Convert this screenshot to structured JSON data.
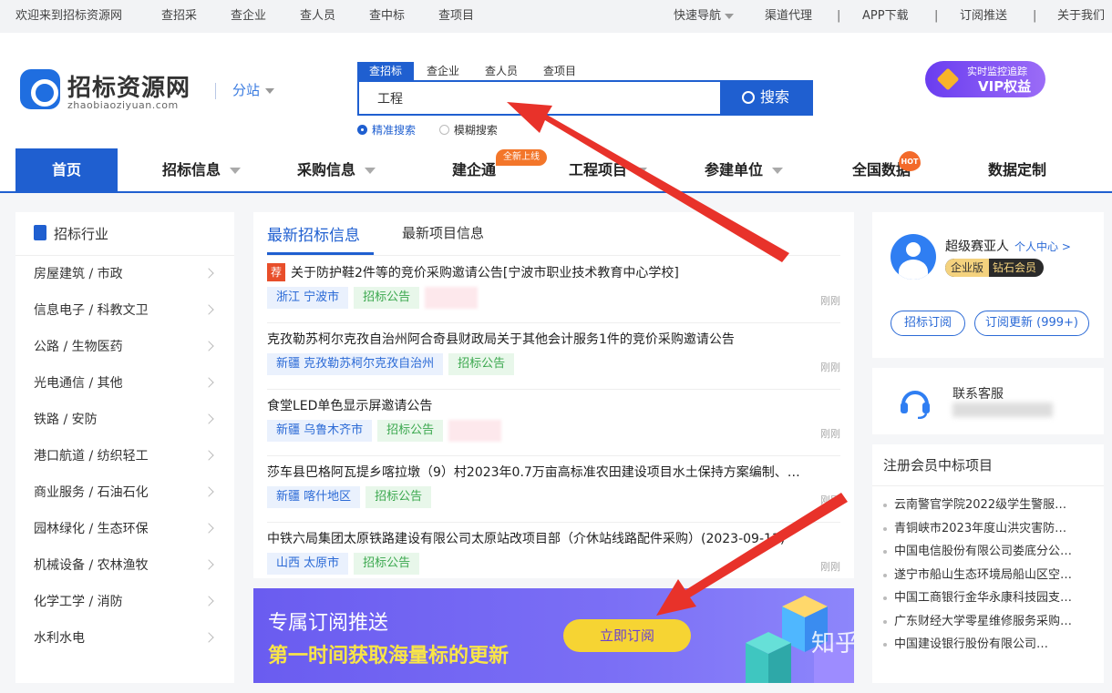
{
  "topbar": {
    "welcome": "欢迎来到招标资源网",
    "links": [
      "查招采",
      "查企业",
      "查人员",
      "查中标",
      "查项目"
    ],
    "quick_nav": "快速导航",
    "right_links": [
      "渠道代理",
      "APP下载",
      "订阅推送",
      "关于我们"
    ],
    "separator": "|"
  },
  "header": {
    "logo_name": "招标资源网",
    "logo_domain": "zhaobiaoziyuan.com",
    "substation": "分站",
    "search_tabs": [
      "查招标",
      "查企业",
      "查人员",
      "查项目"
    ],
    "search_value": "工程",
    "search_button": "搜索",
    "opt_precise": "精准搜索",
    "opt_fuzzy": "模糊搜索",
    "vip_line1": "实时监控追踪",
    "vip_line2": "VIP权益"
  },
  "nav": {
    "items": [
      "首页",
      "招标信息",
      "采购信息",
      "建企通",
      "工程项目",
      "参建单位",
      "全国数据",
      "数据定制"
    ],
    "badge_new": "全新上线",
    "badge_hot": "HOT"
  },
  "industry": {
    "title": "招标行业",
    "items": [
      "房屋建筑 / 市政",
      "信息电子 / 科教文卫",
      "公路 / 生物医药",
      "光电通信 / 其他",
      "铁路 / 安防",
      "港口航道 / 纺织轻工",
      "商业服务 / 石油石化",
      "园林绿化 / 生态环保",
      "机械设备 / 农林渔牧",
      "化学工学 / 消防",
      "水利水电"
    ]
  },
  "news": {
    "tabs": [
      "最新招标信息",
      "最新项目信息"
    ],
    "recommend_tag": "荐",
    "rows": [
      {
        "title": "关于防护鞋2件等的竞价采购邀请公告[宁波市职业技术教育中心学校]",
        "region": "浙江 宁波市",
        "type": "招标公告",
        "time": "刚刚"
      },
      {
        "title": "克孜勒苏柯尔克孜自治州阿合奇县财政局关于其他会计服务1件的竞价采购邀请公告",
        "region": "新疆 克孜勒苏柯尔克孜自治州",
        "type": "招标公告",
        "time": "刚刚"
      },
      {
        "title": "食堂LED单色显示屏邀请公告",
        "region": "新疆 乌鲁木齐市",
        "type": "招标公告",
        "time": "刚刚"
      },
      {
        "title": "莎车县巴格阿瓦提乡喀拉墩（9）村2023年0.7万亩高标准农田建设项目水土保持方案编制、…",
        "region": "新疆 喀什地区",
        "type": "招标公告",
        "time": "刚刚"
      },
      {
        "title": "中铁六局集团太原铁路建设有限公司太原站改项目部（介休站线路配件采购）(2023-09-13)",
        "region": "山西 太原市",
        "type": "招标公告",
        "time": "刚刚"
      }
    ]
  },
  "banner": {
    "title": "专属订阅推送",
    "subtitle": "第一时间获取海量标的更新",
    "cta": "立即订阅",
    "watermark": "知乎 @招标资源网"
  },
  "user": {
    "name": "超级赛亚人",
    "center_link": "个人中心 >",
    "badge_edition": "企业版",
    "badge_level": "钻石会员",
    "btn_subscribe": "招标订阅",
    "btn_updates": "订阅更新 (999+)"
  },
  "service": {
    "label": "联系客服"
  },
  "winners": {
    "title": "注册会员中标项目",
    "items": [
      "云南警官学院2022级学生警服…",
      "青铜峡市2023年度山洪灾害防…",
      "中国电信股份有限公司娄底分公…",
      "遂宁市船山生态环境局船山区空…",
      "中国工商银行金华永康科技园支…",
      "广东财经大学零星维修服务采购…",
      "中国建设银行股份有限公司…"
    ]
  },
  "colors": {
    "brand_blue": "#1f5fd0",
    "annotation_red": "#e8322a",
    "banner_purple": "#6a5cf0",
    "cta_yellow": "#f6d433"
  }
}
